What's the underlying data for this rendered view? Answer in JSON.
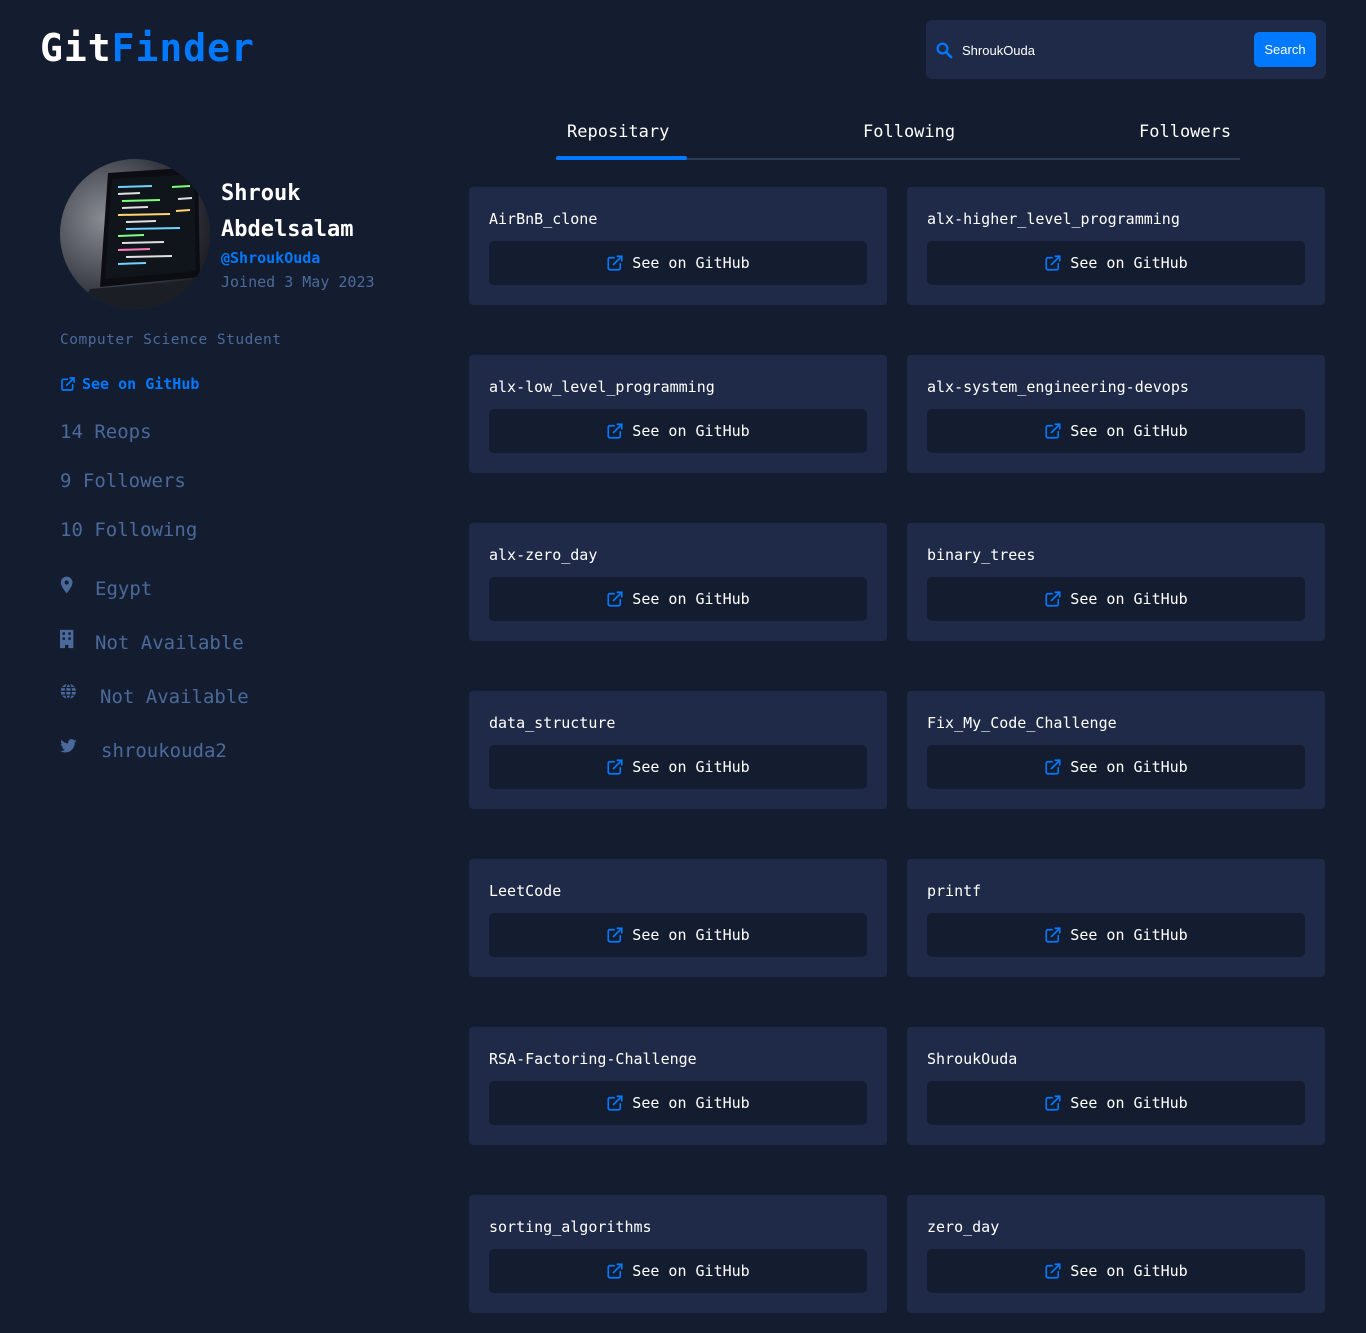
{
  "header": {
    "logo_part1": "Git",
    "logo_part2": "Finder",
    "search_value": "ShroukOuda",
    "search_button": "Search"
  },
  "tabs": [
    {
      "label": "Repositary",
      "active": true
    },
    {
      "label": "Following",
      "active": false
    },
    {
      "label": "Followers",
      "active": false
    }
  ],
  "profile": {
    "name_line1": "Shrouk",
    "name_line2": "Abdelsalam",
    "login": "@ShroukOuda",
    "joined": "Joined 3 May 2023",
    "bio": "Computer Science Student",
    "github_link": "See on GitHub",
    "repos": "14 Reops",
    "followers": "9 Followers",
    "following": "10 Following",
    "location": "Egypt",
    "company": "Not Available",
    "blog": "Not Available",
    "twitter": "shroukouda2"
  },
  "repositories": [
    {
      "name": "AirBnB_clone",
      "link": "See on GitHub"
    },
    {
      "name": "alx-higher_level_programming",
      "link": "See on GitHub"
    },
    {
      "name": "alx-low_level_programming",
      "link": "See on GitHub"
    },
    {
      "name": "alx-system_engineering-devops",
      "link": "See on GitHub"
    },
    {
      "name": "alx-zero_day",
      "link": "See on GitHub"
    },
    {
      "name": "binary_trees",
      "link": "See on GitHub"
    },
    {
      "name": "data_structure",
      "link": "See on GitHub"
    },
    {
      "name": "Fix_My_Code_Challenge",
      "link": "See on GitHub"
    },
    {
      "name": "LeetCode",
      "link": "See on GitHub"
    },
    {
      "name": "printf",
      "link": "See on GitHub"
    },
    {
      "name": "RSA-Factoring-Challenge",
      "link": "See on GitHub"
    },
    {
      "name": "ShroukOuda",
      "link": "See on GitHub"
    },
    {
      "name": "sorting_algorithms",
      "link": "See on GitHub"
    },
    {
      "name": "zero_day",
      "link": "See on GitHub"
    }
  ],
  "colors": {
    "background": "#141d2f",
    "card": "#1e2a47",
    "accent": "#0079ff",
    "muted": "#4b6a9b"
  }
}
